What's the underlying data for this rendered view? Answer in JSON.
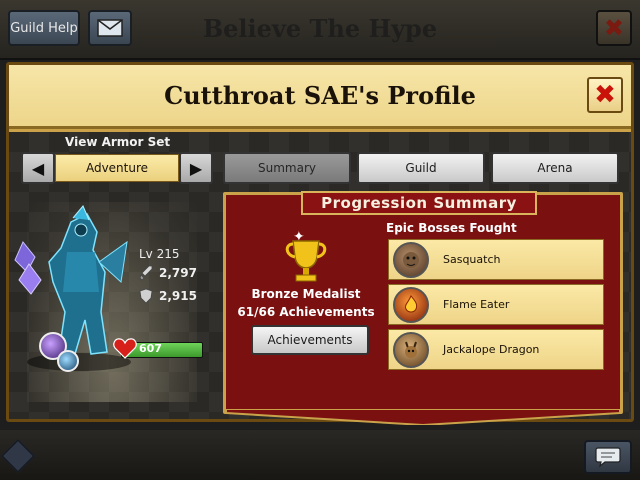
{
  "top_bar": {
    "guild_help_label": "Guild Help",
    "mail_icon": "envelope-icon",
    "title": "Believe The Hype",
    "close_icon": "close-icon"
  },
  "modal": {
    "title": "Cutthroat SAE's Profile",
    "close_icon": "close-icon"
  },
  "armor_set": {
    "label": "View Armor Set",
    "value": "Adventure",
    "prev_icon": "triangle-left-icon",
    "next_icon": "triangle-right-icon"
  },
  "tabs": [
    {
      "label": "Summary",
      "active": true
    },
    {
      "label": "Guild",
      "active": false
    },
    {
      "label": "Arena",
      "active": false
    }
  ],
  "character": {
    "level": "Lv 215",
    "attack": "2,797",
    "defense": "2,915",
    "hp": "607",
    "hp_fill_fraction": 1.0,
    "attack_icon": "sword-icon",
    "defense_icon": "shield-icon",
    "hp_icon": "heart-icon"
  },
  "progression": {
    "title": "Progression Summary",
    "medal": "Bronze Medalist",
    "achievements_count": "61/66 Achievements",
    "achievements_button": "Achievements",
    "bosses_label": "Epic Bosses Fought",
    "bosses": [
      {
        "name": "Sasquatch",
        "icon": "sasquatch-icon"
      },
      {
        "name": "Flame Eater",
        "icon": "flame-eater-icon"
      },
      {
        "name": "Jackalope Dragon",
        "icon": "jackalope-dragon-icon"
      }
    ]
  },
  "bottom_bar": {
    "menu_icon": "menu-diamond-icon",
    "chat_icon": "chat-bubble-icon"
  },
  "colors": {
    "panel_red": "#7a1010",
    "gold": "#c9a24a",
    "parchment": "#f7e6a8",
    "close_red": "#c8120a",
    "hp_green": "#4caf3a"
  }
}
